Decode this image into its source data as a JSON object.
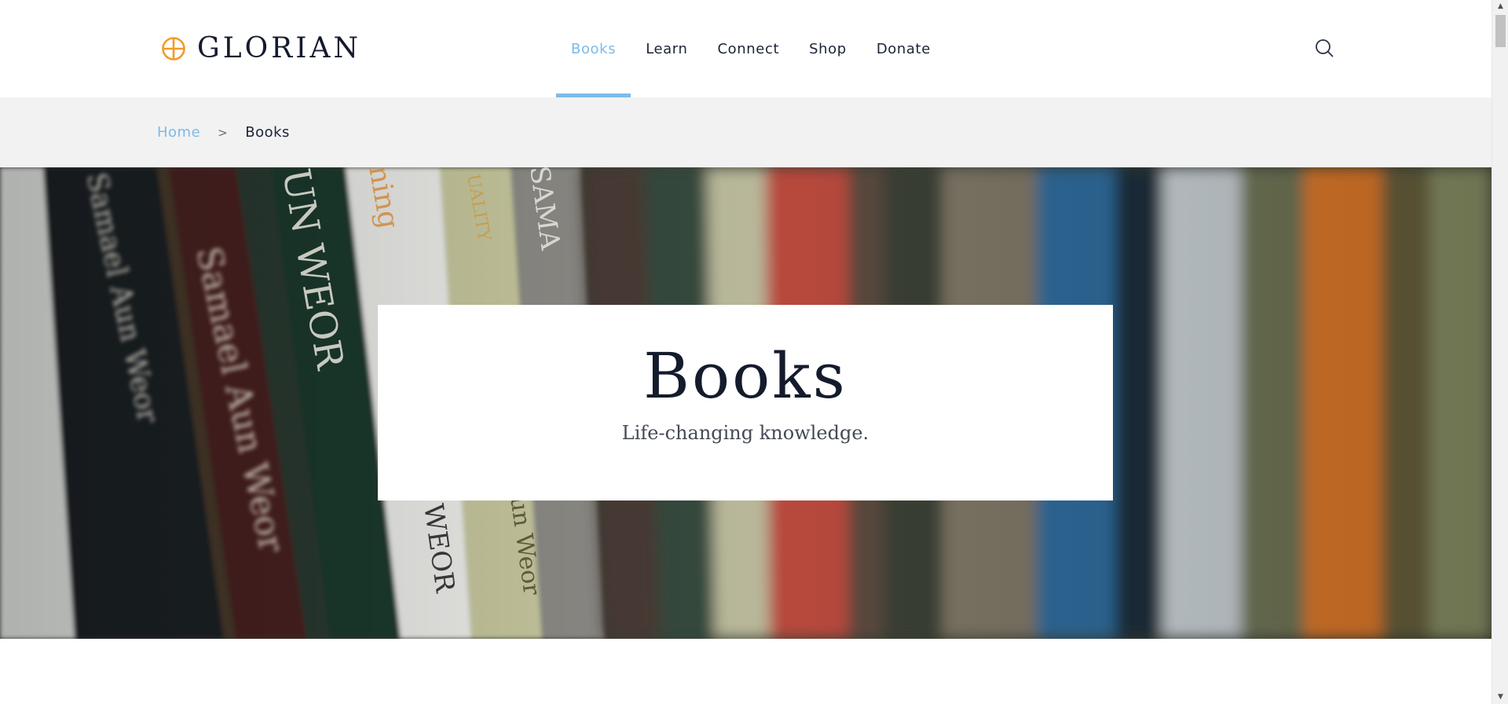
{
  "brand": {
    "name": "GLORIAN",
    "logo_icon": "cross-circle-icon",
    "accent_color": "#f39a2a"
  },
  "nav": {
    "items": [
      {
        "label": "Books",
        "active": true
      },
      {
        "label": "Learn",
        "active": false
      },
      {
        "label": "Connect",
        "active": false
      },
      {
        "label": "Shop",
        "active": false
      },
      {
        "label": "Donate",
        "active": false
      }
    ],
    "active_color": "#7cbbe8",
    "search_icon": "search-icon"
  },
  "breadcrumb": {
    "home": "Home",
    "separator": ">",
    "current": "Books"
  },
  "hero": {
    "title": "Books",
    "subtitle": "Life-changing knowledge.",
    "background": "blurred-bookshelf-photo",
    "spine_texts": [
      "Samael Aun Weor",
      "UN WEOR",
      "WEOR",
      "ning",
      "UALITY",
      "SAMA",
      "un Weor"
    ]
  },
  "scrollbar": {
    "up_icon": "triangle-up-icon",
    "down_icon": "triangle-down-icon"
  }
}
